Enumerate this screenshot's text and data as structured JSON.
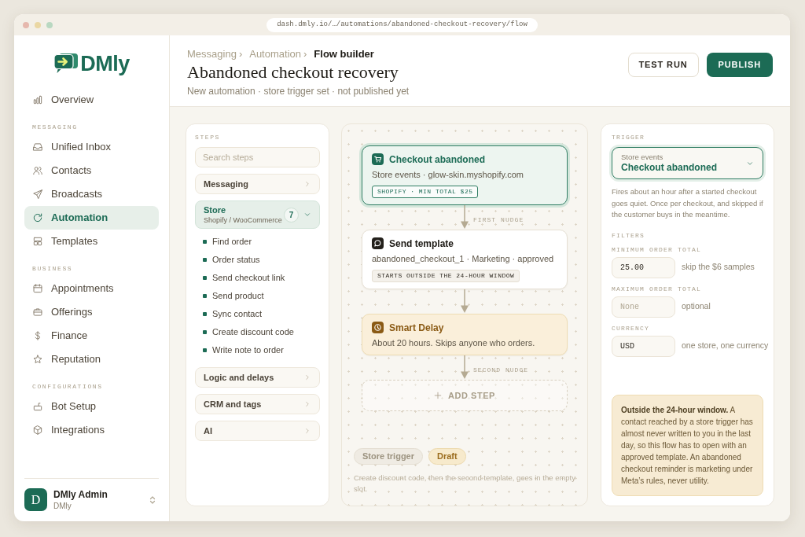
{
  "browser": {
    "url": "dash.dmly.io/…/automations/abandoned-checkout-recovery/flow"
  },
  "sidebar": {
    "brand": "DMly",
    "sections": [
      {
        "items": [
          {
            "label": "Overview",
            "selected": false
          }
        ]
      },
      {
        "label": "MESSAGING",
        "items": [
          {
            "label": "Unified Inbox",
            "selected": false
          },
          {
            "label": "Contacts",
            "selected": false
          },
          {
            "label": "Broadcasts",
            "selected": false
          },
          {
            "label": "Automation",
            "selected": true
          },
          {
            "label": "Templates",
            "selected": false
          }
        ]
      },
      {
        "label": "BUSINESS",
        "items": [
          {
            "label": "Appointments",
            "selected": false
          },
          {
            "label": "Offerings",
            "selected": false
          },
          {
            "label": "Finance",
            "selected": false
          },
          {
            "label": "Reputation",
            "selected": false
          }
        ]
      },
      {
        "label": "CONFIGURATIONS",
        "items": [
          {
            "label": "Bot Setup",
            "selected": false
          },
          {
            "label": "Integrations",
            "selected": false
          }
        ]
      }
    ],
    "user": {
      "initial": "D",
      "name": "DMly Admin",
      "org": "DMly"
    }
  },
  "header": {
    "breadcrumb": [
      {
        "label": "Messaging",
        "separator": "›",
        "current": false
      },
      {
        "label": "Automation",
        "separator": "›",
        "current": false
      },
      {
        "label": "Flow builder",
        "current": true
      }
    ],
    "title": "Abandoned checkout recovery",
    "subtitle": "New automation · store trigger set · not published yet",
    "buttons": [
      {
        "label": "TEST RUN",
        "kind": "secondary"
      },
      {
        "label": "PUBLISH",
        "kind": "primary"
      }
    ]
  },
  "steps_panel": {
    "title": "STEPS",
    "search": {
      "placeholder": "Search steps"
    },
    "groups": [
      {
        "label": "Messaging",
        "expanded": false
      },
      {
        "label": "Store",
        "subtitle": "Shopify / WooCommerce",
        "count": "7",
        "expanded": true,
        "items": [
          {
            "label": "Find order"
          },
          {
            "label": "Order status"
          },
          {
            "label": "Send checkout link"
          },
          {
            "label": "Send product"
          },
          {
            "label": "Sync contact"
          },
          {
            "label": "Create discount code"
          },
          {
            "label": "Write note to order"
          }
        ]
      },
      {
        "label": "Logic and delays",
        "expanded": false
      },
      {
        "label": "CRM and tags",
        "expanded": false
      },
      {
        "label": "AI",
        "expanded": false
      }
    ]
  },
  "canvas": {
    "nodes": [
      {
        "kind": "trigger",
        "selected": true,
        "title": "Checkout abandoned",
        "detail": "Store events · glow-skin.myshopify.com",
        "tag": "SHOPIFY · MIN TOTAL $25"
      },
      {
        "kind": "message",
        "selected": false,
        "connector_label": "FIRST NUDGE",
        "title": "Send template",
        "detail": "abandoned_checkout_1 · Marketing · approved",
        "tag": "STARTS OUTSIDE THE 24-HOUR WINDOW"
      },
      {
        "kind": "delay",
        "selected": false,
        "title": "Smart Delay",
        "detail": "About 20 hours. Skips anyone who orders."
      },
      {
        "kind": "add",
        "selected": false,
        "connector_label": "SECOND NUDGE",
        "label": "ADD STEP"
      }
    ],
    "badges": [
      {
        "label": "Store trigger",
        "kind": "neutral"
      },
      {
        "label": "Draft",
        "kind": "draft"
      }
    ],
    "note": "Create discount code, then the second template, goes in the empty slot."
  },
  "trigger_panel": {
    "title": "TRIGGER",
    "select": {
      "label": "Store events",
      "value": "Checkout abandoned"
    },
    "description": "Fires about an hour after a started checkout goes quiet. Once per checkout, and skipped if the customer buys in the meantime.",
    "filters_title": "FILTERS",
    "fields": [
      {
        "label": "MINIMUM ORDER TOTAL",
        "value": "25.00",
        "hint": "skip the $6 samples"
      },
      {
        "label": "MAXIMUM ORDER TOTAL",
        "placeholder": "None",
        "hint": "optional"
      },
      {
        "label": "CURRENCY",
        "value": "USD",
        "hint": "one store, one currency"
      }
    ],
    "callout": "**Outside the 24-hour window.** A contact reached by a store trigger has almost never written to you in the last day, so this flow has to open with an approved template. An abandoned checkout reminder is marketing under Meta’s rules, never utility."
  }
}
